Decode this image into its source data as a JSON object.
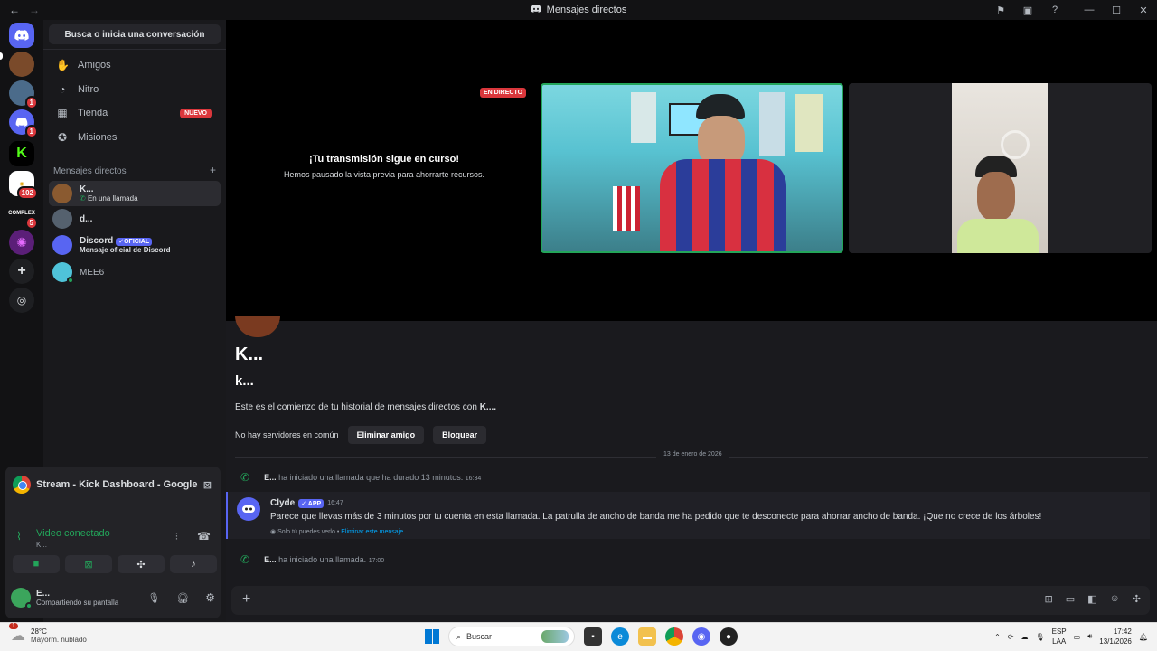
{
  "window": {
    "title": "Mensajes directos"
  },
  "guilds": [
    {
      "name": "discord-home",
      "badge": ""
    },
    {
      "name": "server-1",
      "badge": ""
    },
    {
      "name": "server-2",
      "badge": "1"
    },
    {
      "name": "server-3",
      "badge": "1"
    },
    {
      "name": "server-kick",
      "badge": ""
    },
    {
      "name": "server-102",
      "badge": "102"
    },
    {
      "name": "server-complex",
      "badge": "5"
    },
    {
      "name": "server-7",
      "badge": ""
    }
  ],
  "sidebar": {
    "search_label": "Busca o inicia una conversación",
    "nav": [
      {
        "label": "Amigos"
      },
      {
        "label": "Nitro"
      },
      {
        "label": "Tienda",
        "badge": "NUEVO"
      },
      {
        "label": "Misiones"
      }
    ],
    "dm_header": "Mensajes directos",
    "dm_add": "+",
    "dms": [
      {
        "name": "K...",
        "sub": "En una llamada"
      },
      {
        "name": "d...",
        "sub": ""
      },
      {
        "name": "Discord",
        "badge": "OFICIAL",
        "sub": "Mensaje oficial de Discord"
      },
      {
        "name": "MEE6",
        "sub": ""
      }
    ]
  },
  "voice_panel": {
    "stream_title": "Stream - Kick Dashboard - Google ...",
    "status": "Video conectado",
    "channel": "K...",
    "user_name": "E...",
    "user_status": "Compartiendo su pantalla"
  },
  "stage": {
    "paused_title": "¡Tu transmisión sigue en curso!",
    "paused_sub": "Hemos pausado la vista previa para ahorrarte recursos.",
    "live_label": "EN DIRECTO"
  },
  "chat": {
    "header_name": "K...",
    "username": "k...",
    "intro_prefix": "Este es el comienzo de tu historial de mensajes directos con ",
    "intro_name": "K....",
    "no_servers": "No hay servidores en común",
    "remove_friend": "Eliminar amigo",
    "block": "Bloquear",
    "date_divider": "13 de enero de 2026",
    "sys1_user": "E...",
    "sys1_text": "ha iniciado una llamada que ha durado 13 minutos.",
    "sys1_time": "16:34",
    "msg_author": "Clyde",
    "msg_badge": "APP",
    "msg_time": "16:47",
    "msg_body": "Parece que llevas más de 3 minutos por tu cuenta en esta llamada. La patrulla de ancho de banda me ha pedido que te desconecte para ahorrar ancho de banda. ¡Que no crece de los árboles!",
    "msg_ephemeral": "Solo tú puedes verlo •",
    "msg_delete": "Eliminar este mensaje",
    "sys2_user": "E...",
    "sys2_text": "ha iniciado una llamada.",
    "sys2_time": "17:00"
  },
  "taskbar": {
    "temp": "28°C",
    "weather": "Mayorm. nublado",
    "weather_badge": "1",
    "search_placeholder": "Buscar",
    "lang1": "ESP",
    "lang2": "LAA",
    "time": "17:42",
    "date": "13/1/2026"
  }
}
